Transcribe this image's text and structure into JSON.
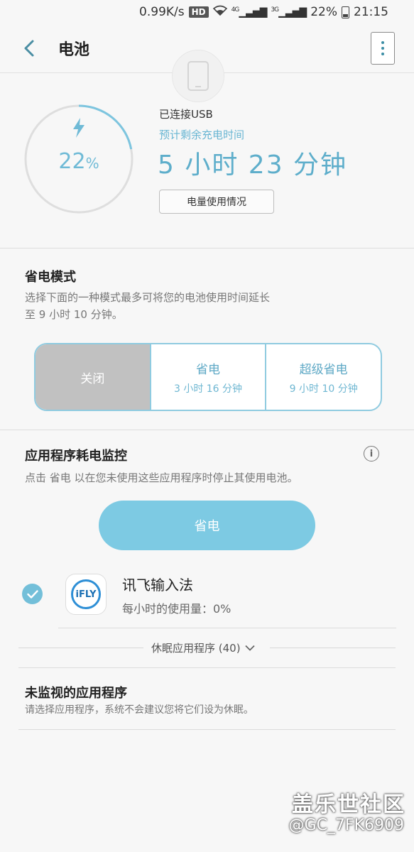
{
  "status_bar": {
    "speed": "0.99K/s",
    "hd": "HD",
    "net_4g": "4G",
    "net_3g": "3G",
    "battery": "22%",
    "time": "21:15"
  },
  "app_bar": {
    "title": "电池"
  },
  "battery": {
    "percent_value": "22",
    "percent_sign": "%",
    "level": 0.22,
    "connection": "已连接USB",
    "estimate_label": "预计剩余充电时间",
    "estimate_time": "5 小时 23 分钟",
    "usage_button": "电量使用情况"
  },
  "power_mode": {
    "title": "省电模式",
    "description_line1": "选择下面的一种模式最多可将您的电池使用时间延长",
    "description_line2": "至 9 小时 10 分钟。",
    "options": [
      {
        "label": "关闭",
        "sub": ""
      },
      {
        "label": "省电",
        "sub": "3 小时 16 分钟"
      },
      {
        "label": "超级省电",
        "sub": "9 小时 10 分钟"
      }
    ]
  },
  "monitor": {
    "title": "应用程序耗电监控",
    "info_icon": "i",
    "description": "点击 省电 以在您未使用这些应用程序时停止其使用电池。",
    "save_button": "省电",
    "app": {
      "icon_text": "iFLY",
      "name": "讯飞输入法",
      "usage": "每小时的使用量：0%"
    }
  },
  "sleeping_apps": {
    "label": "休眠应用程序 (40)"
  },
  "unmonitored": {
    "title": "未监视的应用程序",
    "description": "请选择应用程序，系统不会建议您将它们设为休眠。"
  },
  "watermark": {
    "brand": "盖乐世社区",
    "user": "@GC_7FK6909"
  },
  "colors": {
    "accent": "#6fbad6",
    "button": "#7dcae3",
    "active_segment": "#c1c1c1"
  }
}
